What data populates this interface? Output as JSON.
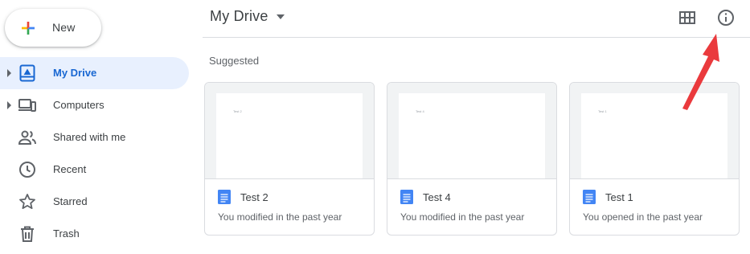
{
  "new_button": {
    "label": "New"
  },
  "sidebar": {
    "items": [
      {
        "label": "My Drive",
        "active": true,
        "icon": "my-drive-icon"
      },
      {
        "label": "Computers",
        "active": false,
        "icon": "computers-icon"
      },
      {
        "label": "Shared with me",
        "active": false,
        "icon": "shared-with-me-icon"
      },
      {
        "label": "Recent",
        "active": false,
        "icon": "recent-clock-icon"
      },
      {
        "label": "Starred",
        "active": false,
        "icon": "star-icon"
      },
      {
        "label": "Trash",
        "active": false,
        "icon": "trash-icon"
      }
    ]
  },
  "header": {
    "title": "My Drive",
    "view_toggle_icon": "grid-view-icon",
    "details_icon": "info-icon"
  },
  "main": {
    "section_title": "Suggested",
    "files": [
      {
        "name": "Test 2",
        "meta": "You modified in the past year",
        "thumb_text": "Test 2"
      },
      {
        "name": "Test 4",
        "meta": "You modified in the past year",
        "thumb_text": "Test 4"
      },
      {
        "name": "Test 1",
        "meta": "You opened in the past year",
        "thumb_text": "Test 1"
      }
    ]
  },
  "colors": {
    "accent": "#1967d2",
    "active_bg": "#e8f0fe",
    "doc_blue": "#4285f4",
    "annotation_arrow": "#ea3a3d"
  }
}
